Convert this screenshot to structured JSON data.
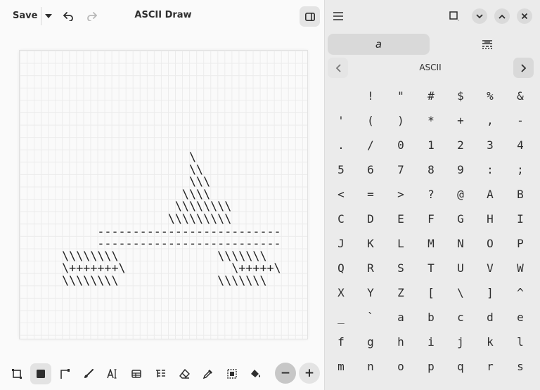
{
  "header": {
    "save_label": "Save",
    "title": "ASCII Draw"
  },
  "canvas": {
    "art_lines": [
      "                     \\",
      "                     \\\\",
      "                     \\\\\\",
      "                    \\\\\\\\",
      "                   \\\\\\\\\\\\\\\\",
      "                  \\\\\\\\\\\\\\\\\\",
      "        --------------------------",
      "        --------------------------",
      "   \\\\\\\\\\\\\\\\              \\\\\\\\\\\\\\",
      "   \\+++++++\\               \\+++++\\",
      "   \\\\\\\\\\\\\\\\              \\\\\\\\\\\\\\"
    ]
  },
  "toolbar": {
    "tools": [
      "rectangle-tool-icon",
      "filled-rectangle-tool-icon",
      "line-tool-icon",
      "freehand-brush-icon",
      "text-tool-icon",
      "table-tool-icon",
      "tree-tool-icon",
      "eraser-tool-icon",
      "picker-tool-icon",
      "select-tool-icon",
      "fill-tool-icon"
    ],
    "active_tool": "filled-rectangle-tool-icon",
    "zoom_out_label": "−",
    "zoom_in_label": "+"
  },
  "sidebar": {
    "tabs": [
      "character-tab-icon",
      "font-style-tab-icon"
    ],
    "tab_char_label": "a",
    "charset_name": "ASCII",
    "chars": [
      "!",
      "\"",
      "#",
      "$",
      "%",
      "&",
      "'",
      "(",
      ")",
      "*",
      "+",
      ",",
      "-",
      ".",
      "/",
      "0",
      "1",
      "2",
      "3",
      "4",
      "5",
      "6",
      "7",
      "8",
      "9",
      ":",
      ";",
      "<",
      "=",
      ">",
      "?",
      "@",
      "A",
      "B",
      "C",
      "D",
      "E",
      "F",
      "G",
      "H",
      "I",
      "J",
      "K",
      "L",
      "M",
      "N",
      "O",
      "P",
      "Q",
      "R",
      "S",
      "T",
      "U",
      "V",
      "W",
      "X",
      "Y",
      "Z",
      "[",
      "\\",
      "]",
      "^",
      "_",
      "`",
      "a",
      "b",
      "c",
      "d",
      "e",
      "f",
      "g",
      "h",
      "i",
      "j",
      "k",
      "l",
      "m",
      "n",
      "o",
      "p",
      "q",
      "r",
      "s"
    ]
  },
  "colors": {
    "accent": "#d9d9d9",
    "grid": "#ececec",
    "sidebar_bg": "#ebebeb"
  }
}
